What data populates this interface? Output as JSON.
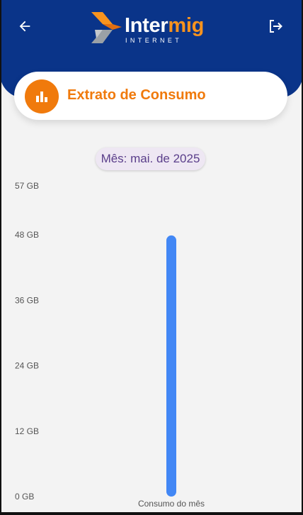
{
  "header": {
    "back_icon": "arrow-left-icon",
    "logout_icon": "logout-icon",
    "logo": {
      "word_white": "Inter",
      "word_orange": "mig",
      "tagline": "INTERNET"
    },
    "colors": {
      "background": "#0a3489",
      "accent": "#f7931e"
    }
  },
  "title_card": {
    "icon": "bar-chart-icon",
    "title": "Extrato de Consumo",
    "accent": "#f07a0c"
  },
  "month_chip": {
    "label": "Mês: mai. de 2025"
  },
  "chart_data": {
    "type": "bar",
    "categories": [
      "Consumo do mês"
    ],
    "values": [
      47.9
    ],
    "ylim": [
      0,
      57
    ],
    "ytick_labels": [
      {
        "value": 57,
        "label": "57 GB"
      },
      {
        "value": 48,
        "label": "48 GB"
      },
      {
        "value": 36,
        "label": "36 GB"
      },
      {
        "value": 24,
        "label": "24 GB"
      },
      {
        "value": 12,
        "label": "12 GB"
      },
      {
        "value": 0,
        "label": "0 GB"
      }
    ],
    "bar_color": "#4287f5",
    "grid": false,
    "title": "",
    "xlabel": "",
    "ylabel": ""
  }
}
